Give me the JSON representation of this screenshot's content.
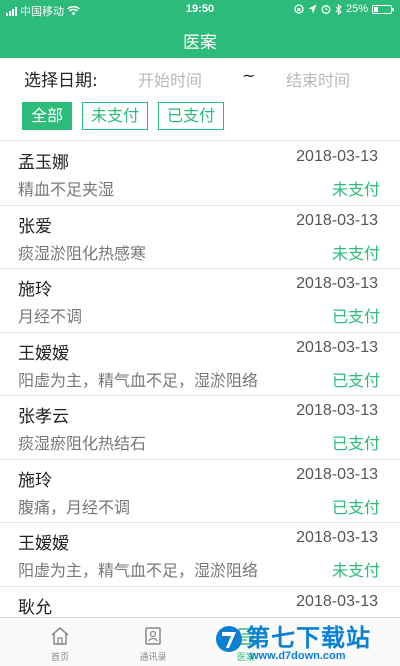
{
  "status_bar": {
    "carrier": "中国移动",
    "time": "19:50",
    "battery": "25%"
  },
  "header": {
    "title": "医案"
  },
  "date_filter": {
    "label": "选择日期:",
    "start_placeholder": "开始时间",
    "separator": "~",
    "end_placeholder": "结束时间"
  },
  "filters": [
    {
      "label": "全部",
      "active": true
    },
    {
      "label": "未支付",
      "active": false
    },
    {
      "label": "已支付",
      "active": false
    }
  ],
  "records": [
    {
      "name": "孟玉娜",
      "date": "2018-03-13",
      "diagnosis": "精血不足夹湿",
      "status": "未支付"
    },
    {
      "name": "张爱",
      "date": "2018-03-13",
      "diagnosis": "痰湿淤阻化热感寒",
      "status": "未支付"
    },
    {
      "name": "施玲",
      "date": "2018-03-13",
      "diagnosis": "月经不调",
      "status": "已支付"
    },
    {
      "name": "王嫒嫒",
      "date": "2018-03-13",
      "diagnosis": "阳虚为主，精气血不足，湿淤阻络",
      "status": "已支付"
    },
    {
      "name": "张孝云",
      "date": "2018-03-13",
      "diagnosis": "痰湿瘀阻化热结石",
      "status": "已支付"
    },
    {
      "name": "施玲",
      "date": "2018-03-13",
      "diagnosis": "腹痛，月经不调",
      "status": "已支付"
    },
    {
      "name": "王嫒嫒",
      "date": "2018-03-13",
      "diagnosis": "阳虚为主，精气血不足，湿淤阻络",
      "status": "未支付"
    },
    {
      "name": "耿允",
      "date": "2018-03-13",
      "diagnosis": "",
      "status": ""
    }
  ],
  "tabbar": {
    "items": [
      {
        "label": "首页",
        "icon": "home-icon"
      },
      {
        "label": "通讯录",
        "icon": "contacts-icon"
      },
      {
        "label": "医案",
        "icon": "case-icon",
        "active": true
      }
    ]
  },
  "watermark": {
    "text": "第七下载站",
    "url": "www.d7down.com"
  },
  "colors": {
    "accent": "#2cbb7a",
    "watermark": "#0a7fd6"
  }
}
